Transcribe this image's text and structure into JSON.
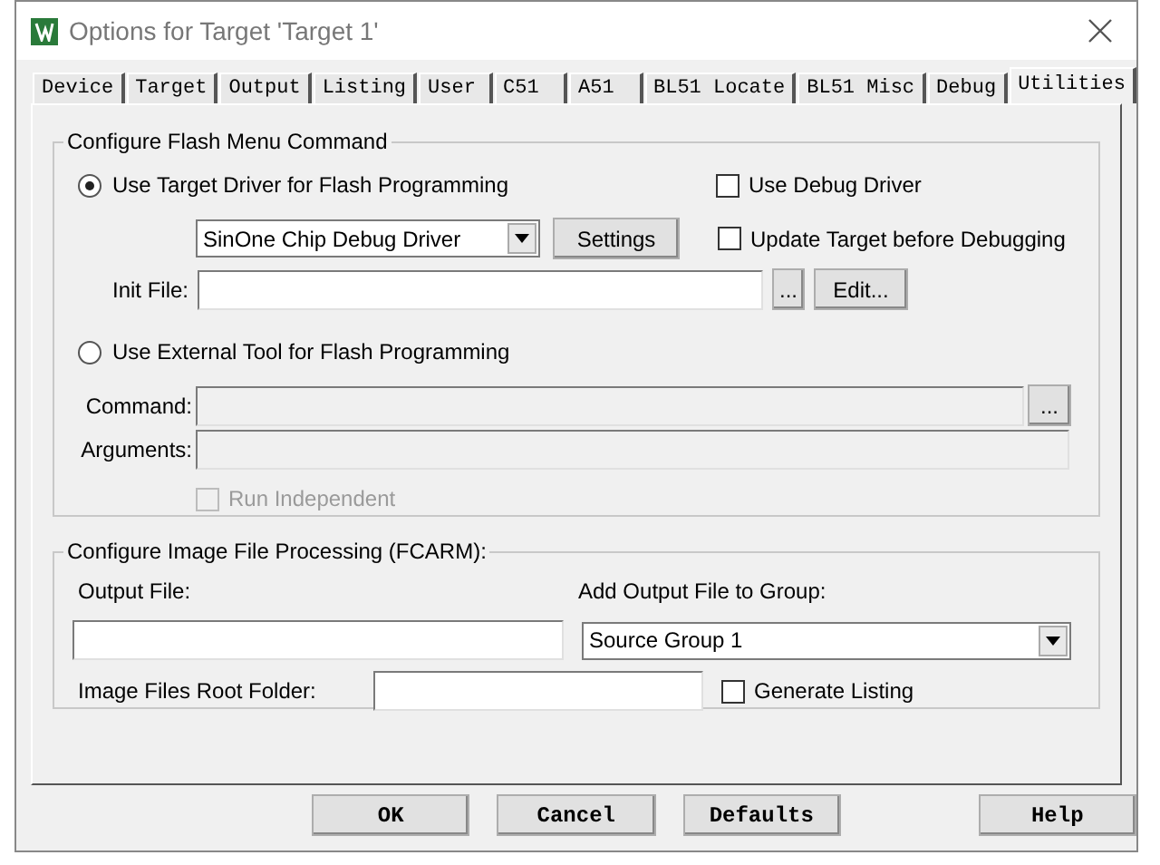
{
  "window": {
    "title": "Options for Target 'Target 1'"
  },
  "tabs": [
    {
      "label": "Device",
      "selected": false
    },
    {
      "label": "Target",
      "selected": false
    },
    {
      "label": "Output",
      "selected": false
    },
    {
      "label": "Listing",
      "selected": false
    },
    {
      "label": "User",
      "selected": false
    },
    {
      "label": "C51",
      "selected": false
    },
    {
      "label": "A51",
      "selected": false
    },
    {
      "label": "BL51 Locate",
      "selected": false
    },
    {
      "label": "BL51 Misc",
      "selected": false
    },
    {
      "label": "Debug",
      "selected": false
    },
    {
      "label": "Utilities",
      "selected": true
    }
  ],
  "flash": {
    "legend": "Configure Flash Menu Command",
    "modes": [
      {
        "label": "Use Target Driver for Flash Programming",
        "selected": true
      },
      {
        "label": "Use External Tool for Flash Programming",
        "selected": false
      }
    ],
    "driver": {
      "value": "SinOne Chip Debug Driver"
    },
    "settings_button": "Settings",
    "use_debug_driver": {
      "label": "Use Debug Driver",
      "checked": false
    },
    "update_target": {
      "label": "Update Target before Debugging",
      "checked": false
    },
    "init_file": {
      "label": "Init File:",
      "browse": "...",
      "edit": "Edit..."
    },
    "command": {
      "label": "Command:",
      "browse": "...",
      "disabled": true
    },
    "arguments": {
      "label": "Arguments:",
      "disabled": true
    },
    "run_independent": {
      "label": "Run Independent",
      "checked": false,
      "disabled": true
    }
  },
  "image": {
    "legend": "Configure Image File Processing (FCARM):",
    "output_file_label": "Output File:",
    "group_label": "Add Output File  to Group:",
    "group_value": "Source Group 1",
    "root_folder_label": "Image Files Root Folder:",
    "generate_listing": {
      "label": "Generate Listing",
      "checked": false
    }
  },
  "buttons": [
    {
      "label": "OK"
    },
    {
      "label": "Cancel"
    },
    {
      "label": "Defaults"
    },
    {
      "label": "Help"
    }
  ]
}
